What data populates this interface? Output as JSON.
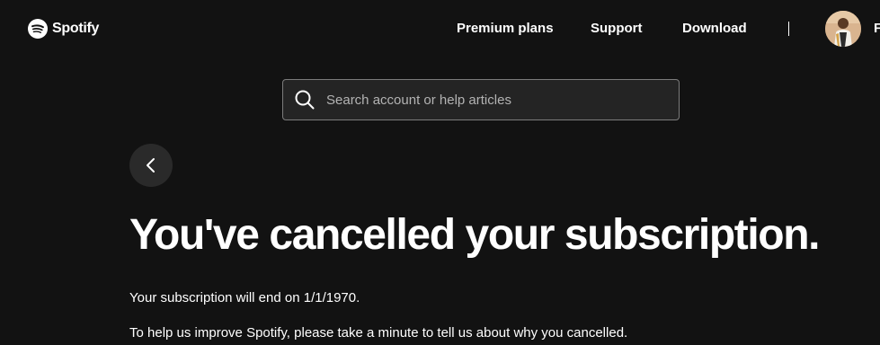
{
  "header": {
    "brand": "Spotify",
    "nav": {
      "premium_plans": "Premium plans",
      "support": "Support",
      "download": "Download"
    },
    "profile_initial": "F",
    "logo_icon": "spotify-logo-icon",
    "avatar_icon": "user-avatar"
  },
  "search": {
    "placeholder": "Search account or help articles",
    "value": "",
    "icon": "search-icon"
  },
  "back": {
    "icon": "chevron-left-icon"
  },
  "main": {
    "title": "You've cancelled your subscription.",
    "subscription_end": "Your subscription will end on 1/1/1970.",
    "feedback_prompt": "To help us improve Spotify, please take a minute to tell us about why you cancelled."
  },
  "colors": {
    "background": "#121212",
    "text": "#ffffff",
    "search_background": "#242424",
    "search_border": "#7c7c7c",
    "placeholder": "#b3b3b3",
    "back_button": "#2a2a2a"
  }
}
